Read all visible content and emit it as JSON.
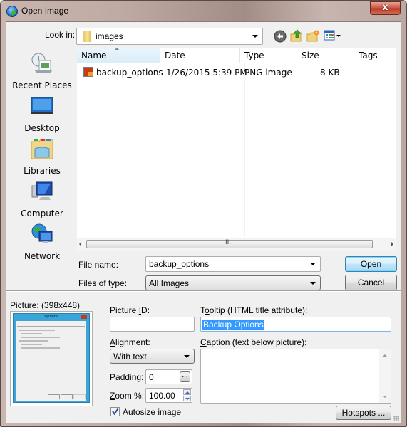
{
  "window": {
    "title": "Open Image",
    "close_label": "x"
  },
  "look_in": {
    "label": "Look in:",
    "value": "images"
  },
  "toolbar": {
    "icons": [
      "back-icon",
      "up-folder-icon",
      "new-folder-icon",
      "view-menu-icon"
    ]
  },
  "places": [
    {
      "label": "Recent Places",
      "icon": "recent-places-icon"
    },
    {
      "label": "Desktop",
      "icon": "desktop-icon"
    },
    {
      "label": "Libraries",
      "icon": "libraries-icon"
    },
    {
      "label": "Computer",
      "icon": "computer-icon"
    },
    {
      "label": "Network",
      "icon": "network-icon"
    }
  ],
  "file_list": {
    "columns": [
      "Name",
      "Date",
      "Type",
      "Size",
      "Tags"
    ],
    "sorted_column": "Name",
    "rows": [
      {
        "name": "backup_options",
        "date": "1/26/2015 5:39 PM",
        "type": "PNG image",
        "size": "8 KB",
        "tags": ""
      }
    ],
    "scroll_grip": "III"
  },
  "file_name": {
    "label": "File name:",
    "value": "backup_options"
  },
  "files_of_type": {
    "label": "Files of type:",
    "value": "All Images"
  },
  "buttons": {
    "open": "Open",
    "cancel": "Cancel",
    "hotspots": "Hotspots ..."
  },
  "picture": {
    "label": "Picture: (398x448)",
    "preview_title": "Options"
  },
  "picture_id": {
    "label_pre": "Picture ",
    "label_key": "I",
    "label_post": "D:",
    "value": ""
  },
  "tooltip": {
    "label_pre": "T",
    "label_key": "o",
    "label_post": "oltip (HTML title attribute):",
    "value": "Backup Options"
  },
  "alignment": {
    "label_key": "A",
    "label_post": "lignment:",
    "value": "With text"
  },
  "caption": {
    "label_key": "C",
    "label_post": "aption (text below picture):",
    "value": ""
  },
  "padding": {
    "label_key": "P",
    "label_post": "adding:",
    "value": "0",
    "browse_label": "..."
  },
  "zoom": {
    "label_key": "Z",
    "label_post": "oom %:",
    "value": "100.00"
  },
  "autosize": {
    "label": "Autosize image",
    "checked": true
  }
}
